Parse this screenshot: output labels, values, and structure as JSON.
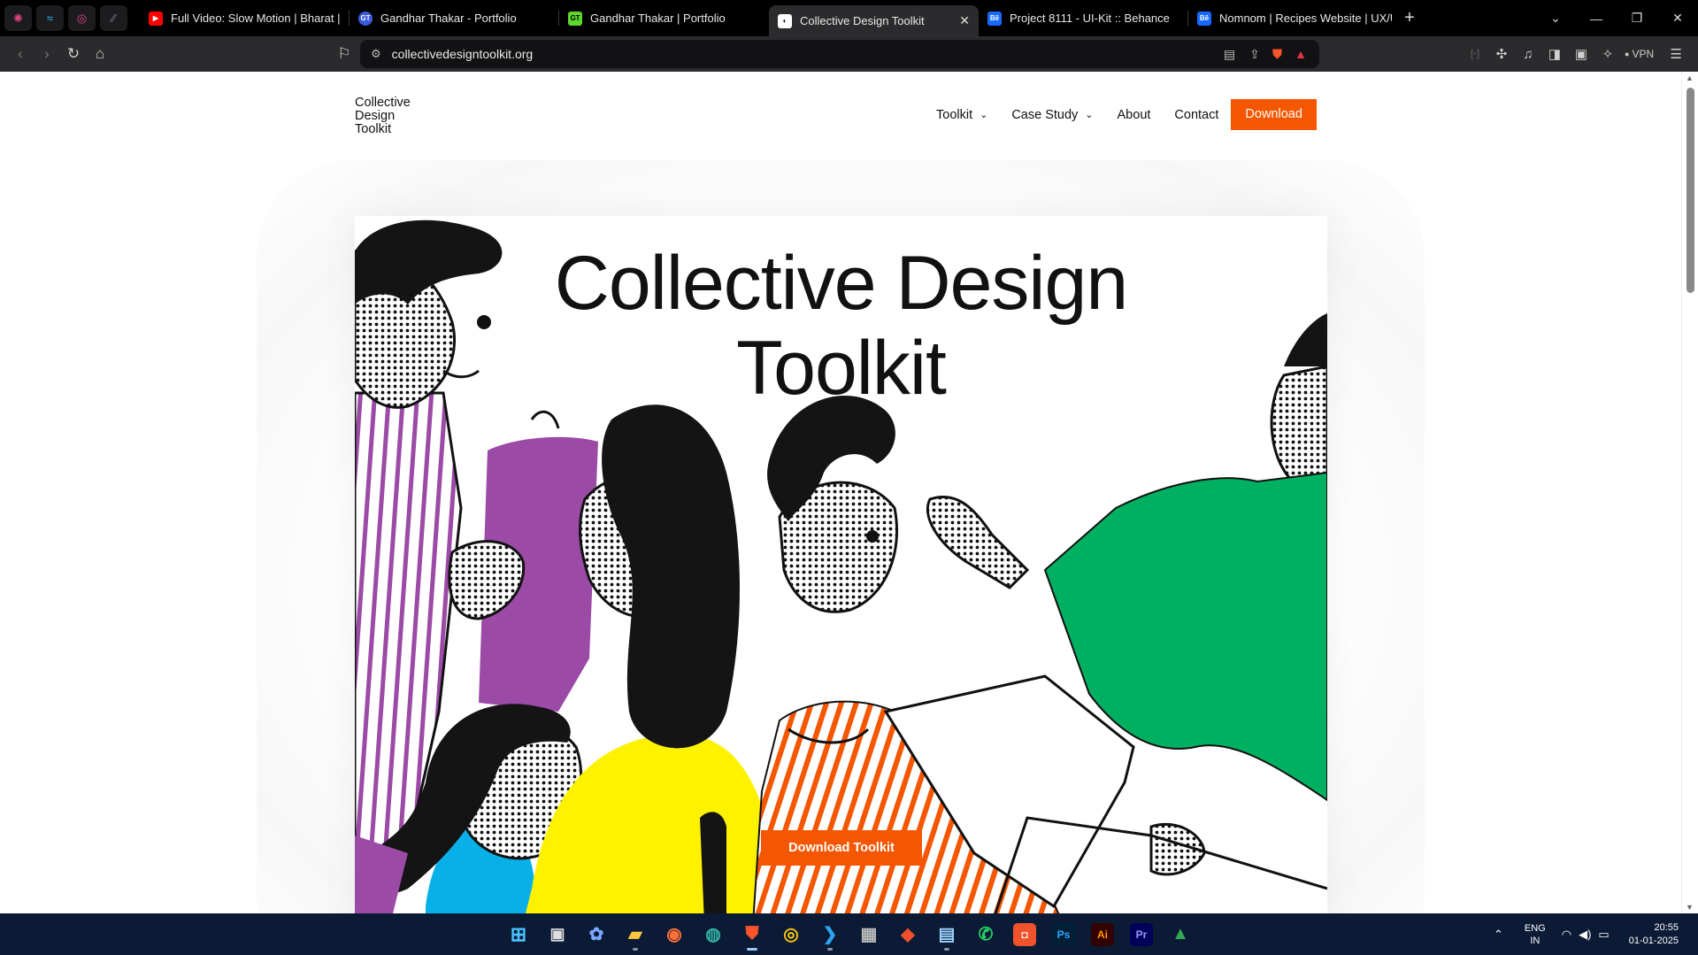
{
  "browser": {
    "pinned_tabs": [
      {
        "icon": "react-icon",
        "color": "#e0457b"
      },
      {
        "icon": "tailwind-icon",
        "color": "#38bdf8"
      },
      {
        "icon": "spiral-icon",
        "color": "#e0457b"
      },
      {
        "icon": "slash-icon",
        "color": "#888888"
      }
    ],
    "tabs": [
      {
        "title": "Full Video: Slow Motion | Bharat | Sa",
        "favicon": "youtube-icon",
        "favicon_color": "#ff0000",
        "active": false
      },
      {
        "title": "Gandhar Thakar - Portfolio",
        "favicon": "gt-circle-icon",
        "favicon_color": "#3b5bdb",
        "favicon_text": "GT",
        "active": false
      },
      {
        "title": "Gandhar Thakar | Portfolio",
        "favicon": "gt-square-icon",
        "favicon_color": "#5cd62c",
        "favicon_text": "GT",
        "active": false
      },
      {
        "title": "Collective Design Toolkit",
        "favicon": "cdt-icon",
        "favicon_color": "#ffffff",
        "active": true
      },
      {
        "title": "Project 8111 - UI-Kit :: Behance",
        "favicon": "behance-icon",
        "favicon_color": "#1769ff",
        "favicon_text": "Bē",
        "active": false
      },
      {
        "title": "Nomnom | Recipes Website | UX/UI",
        "favicon": "behance-icon",
        "favicon_color": "#1769ff",
        "favicon_text": "Bē",
        "active": false
      }
    ],
    "new_tab_label": "+",
    "url": "collectivedesigntoolkit.org",
    "vpn_label": "VPN"
  },
  "site": {
    "logo_lines": [
      "Collective",
      "Design",
      "Toolkit"
    ],
    "nav": [
      {
        "label": "Toolkit",
        "dropdown": true
      },
      {
        "label": "Case Study",
        "dropdown": true
      },
      {
        "label": "About",
        "dropdown": false
      },
      {
        "label": "Contact",
        "dropdown": false
      }
    ],
    "nav_button": "Download",
    "hero_title_line1": "Collective Design",
    "hero_title_line2": "Toolkit",
    "cta_label": "Download Toolkit",
    "accent_color": "#f55600"
  },
  "taskbar": {
    "apps": [
      {
        "name": "windows-start-icon"
      },
      {
        "name": "task-view-icon"
      },
      {
        "name": "copilot-icon"
      },
      {
        "name": "file-explorer-icon"
      },
      {
        "name": "firefox-icon"
      },
      {
        "name": "edge-icon"
      },
      {
        "name": "brave-icon"
      },
      {
        "name": "chrome-icon"
      },
      {
        "name": "vscode-icon"
      },
      {
        "name": "calculator-icon"
      },
      {
        "name": "git-icon"
      },
      {
        "name": "notepad-icon"
      },
      {
        "name": "whatsapp-icon"
      },
      {
        "name": "photo-app-icon"
      },
      {
        "name": "photoshop-icon",
        "text": "Ps"
      },
      {
        "name": "illustrator-icon",
        "text": "Ai"
      },
      {
        "name": "premiere-icon",
        "text": "Pr"
      },
      {
        "name": "drive-icon"
      }
    ],
    "lang_line1": "ENG",
    "lang_line2": "IN",
    "time": "20:55",
    "date": "01-01-2025"
  }
}
